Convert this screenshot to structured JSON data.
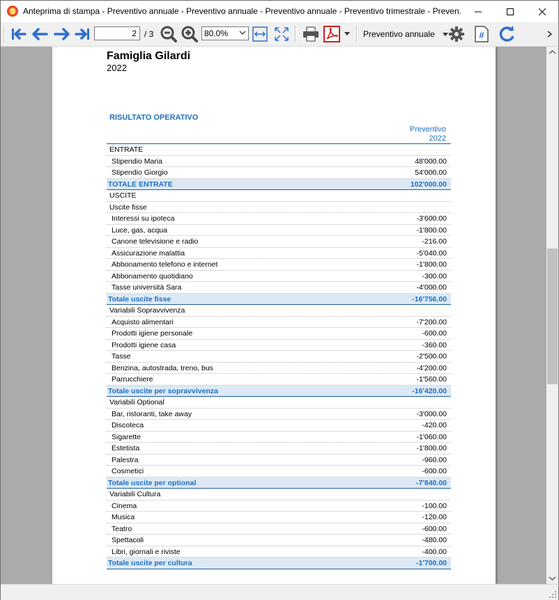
{
  "window": {
    "title": "Anteprima di stampa - Preventivo annuale - Preventivo annuale - Preventivo annuale - Preventivo trimestrale - Preven..."
  },
  "toolbar": {
    "page_current": "2",
    "page_total": "/ 3",
    "zoom": "80.0%",
    "report_selector": "Preventivo annuale"
  },
  "document": {
    "title": "Famiglia Gilardi",
    "year": "2022",
    "section": "RISULTATO OPERATIVO",
    "column_header_line1": "Preventivo",
    "column_header_line2": "2022",
    "rows": [
      {
        "label": "ENTRATE",
        "value": "",
        "type": "section"
      },
      {
        "label": "Stipendio Maria",
        "value": "48'000.00",
        "type": "item"
      },
      {
        "label": "Stipendio Giorgio",
        "value": "54'000.00",
        "type": "item"
      },
      {
        "label": "TOTALE ENTRATE",
        "value": "102'000.00",
        "type": "total"
      },
      {
        "label": "USCITE",
        "value": "",
        "type": "section"
      },
      {
        "label": "Uscite fisse",
        "value": "",
        "type": "section"
      },
      {
        "label": "Interessi su ipoteca",
        "value": "-3'600.00",
        "type": "item"
      },
      {
        "label": "Luce, gas, acqua",
        "value": "-1'800.00",
        "type": "item"
      },
      {
        "label": "Canone televisione e radio",
        "value": "-216.00",
        "type": "item"
      },
      {
        "label": "Assicurazione malattia",
        "value": "-5'040.00",
        "type": "item"
      },
      {
        "label": "Abbonamento telefono e internet",
        "value": "-1'800.00",
        "type": "item"
      },
      {
        "label": "Abbonamento quotidiano",
        "value": "-300.00",
        "type": "item"
      },
      {
        "label": "Tasse università Sara",
        "value": "-4'000.00",
        "type": "item"
      },
      {
        "label": "Totale uscite fisse",
        "value": "-16'756.00",
        "type": "total"
      },
      {
        "label": "Variabili Sopravvivenza",
        "value": "",
        "type": "section"
      },
      {
        "label": "Acquisto alimentari",
        "value": "-7'200.00",
        "type": "item"
      },
      {
        "label": "Prodotti igiene personale",
        "value": "-600.00",
        "type": "item"
      },
      {
        "label": "Prodotti igiene casa",
        "value": "-360.00",
        "type": "item"
      },
      {
        "label": "Tasse",
        "value": "-2'500.00",
        "type": "item"
      },
      {
        "label": "Benzina, autostrada, treno, bus",
        "value": "-4'200.00",
        "type": "item"
      },
      {
        "label": "Parrucchiere",
        "value": "-1'560.00",
        "type": "item"
      },
      {
        "label": "Totale uscite per sopravvivenza",
        "value": "-16'420.00",
        "type": "total"
      },
      {
        "label": "Variabili Optional",
        "value": "",
        "type": "section"
      },
      {
        "label": "Bar, ristoranti, take away",
        "value": "-3'000.00",
        "type": "item"
      },
      {
        "label": "Discoteca",
        "value": "-420.00",
        "type": "item"
      },
      {
        "label": "Sigarette",
        "value": "-1'060.00",
        "type": "item"
      },
      {
        "label": "Estetista",
        "value": "-1'800.00",
        "type": "item"
      },
      {
        "label": "Palestra",
        "value": "-960.00",
        "type": "item"
      },
      {
        "label": "Cosmetici",
        "value": "-600.00",
        "type": "item"
      },
      {
        "label": "Totale uscite per optional",
        "value": "-7'840.00",
        "type": "total"
      },
      {
        "label": "Variabili Cultura",
        "value": "",
        "type": "section"
      },
      {
        "label": "Cinema",
        "value": "-100.00",
        "type": "item"
      },
      {
        "label": "Musica",
        "value": "-120.00",
        "type": "item"
      },
      {
        "label": "Teatro",
        "value": "-600.00",
        "type": "item"
      },
      {
        "label": "Spettacoli",
        "value": "-480.00",
        "type": "item"
      },
      {
        "label": "Libri, giornali e riviste",
        "value": "-400.00",
        "type": "item"
      },
      {
        "label": "Totale uscite per cultura",
        "value": "-1'700.00",
        "type": "total"
      }
    ]
  },
  "colors": {
    "accent_blue": "#1f6fbf",
    "total_row_bg": "#dce9f5",
    "arrow_blue": "#2e6fd0"
  },
  "icons": [
    "app-logo-icon",
    "minimize-icon",
    "maximize-icon",
    "close-icon",
    "first-page-icon",
    "previous-page-icon",
    "next-page-icon",
    "last-page-icon",
    "zoom-out-icon",
    "zoom-in-icon",
    "fit-width-icon",
    "fit-page-icon",
    "print-icon",
    "pdf-icon",
    "settings-gear-icon",
    "page-number-icon",
    "refresh-icon"
  ]
}
